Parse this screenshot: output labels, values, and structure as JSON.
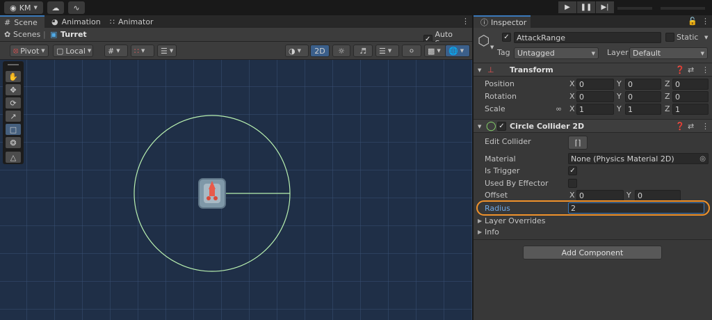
{
  "topbar": {
    "account_label": "KM",
    "account_icon": "user-circle-icon",
    "cloud_icon": "cloud-icon",
    "collab_icon": "version-control-icon",
    "play_icon": "play-icon",
    "pause_icon": "pause-icon",
    "step_icon": "step-icon"
  },
  "scene_panel": {
    "tabs": [
      {
        "label": "Scene",
        "icon": "grid-icon"
      },
      {
        "label": "Animation",
        "icon": "animation-icon"
      },
      {
        "label": "Animator",
        "icon": "animator-icon"
      }
    ],
    "breadcrumb": {
      "root": "Scenes",
      "separator": "|",
      "current": "Turret"
    },
    "auto_save_label": "Auto Save",
    "auto_save_checked": true,
    "toolbar": {
      "pivot_label": "Pivot",
      "space_label": "Local",
      "mode_2d_label": "2D"
    }
  },
  "inspector": {
    "tab_label": "Inspector",
    "object": {
      "name": "AttackRange",
      "active": true,
      "static_label": "Static",
      "tag_label": "Tag",
      "tag_value": "Untagged",
      "layer_label": "Layer",
      "layer_value": "Default"
    },
    "transform": {
      "title": "Transform",
      "rows": [
        {
          "label": "Position",
          "x": "0",
          "y": "0",
          "z": "0"
        },
        {
          "label": "Rotation",
          "x": "0",
          "y": "0",
          "z": "0"
        },
        {
          "label": "Scale",
          "x": "1",
          "y": "1",
          "z": "1"
        }
      ],
      "axis_labels": [
        "X",
        "Y",
        "Z"
      ]
    },
    "circle_collider": {
      "title": "Circle Collider 2D",
      "enabled": true,
      "edit_collider_label": "Edit Collider",
      "material_label": "Material",
      "material_value": "None (Physics Material 2D)",
      "is_trigger_label": "Is Trigger",
      "is_trigger": true,
      "used_by_effector_label": "Used By Effector",
      "used_by_effector": false,
      "offset_label": "Offset",
      "offset_x": "0",
      "offset_y": "0",
      "radius_label": "Radius",
      "radius_value": "2",
      "layer_overrides_label": "Layer Overrides",
      "info_label": "Info"
    },
    "add_component_label": "Add Component"
  },
  "colors": {
    "highlight": "#f0922b",
    "collider": "#b8f0b0",
    "scene_bg": "#1f2f47",
    "accent": "#3a79bb"
  }
}
